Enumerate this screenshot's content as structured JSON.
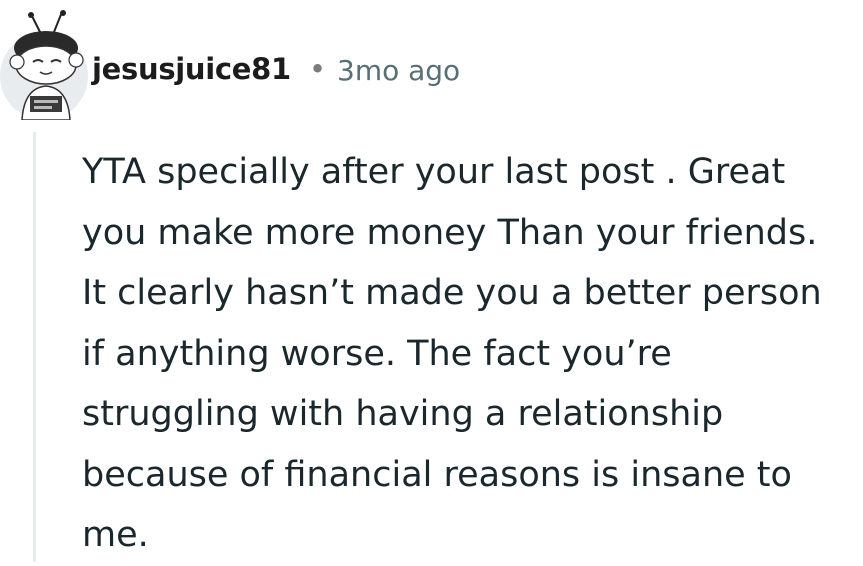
{
  "comment": {
    "author": "jesusjuice81",
    "separator": "•",
    "age": "3mo ago",
    "body": "YTA specially after your last post . Great\nyou make more money Than your friends.\nIt clearly hasn’t made you a better person\nif anything worse. The fact you’re\nstruggling with having a relationship\nbecause of financial reasons is insane to\nme.",
    "avatar_icon": "snoo-avatar-icon"
  }
}
